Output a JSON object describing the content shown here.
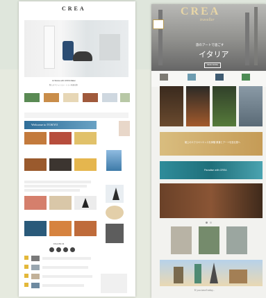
{
  "left_page": {
    "logo": "CREA",
    "nav": [
      "TOP",
      "TRAVEL",
      "GOURMET",
      "BEAUTY",
      "FASHION",
      "LIFESTYLE",
      "CULTURE",
      "MONEY",
      "WEB",
      "SHOP"
    ],
    "hero_caption": "14 Stories with JUNYA Makei",
    "hero_subcaption": "新しいファッション・ショーを巡る旅",
    "welcome_banner": "Welcome to TOKYO",
    "section_label": "FOLLOW US"
  },
  "right_page": {
    "logo": "CREA",
    "logo_script": "traveller",
    "hero_title_small": "旅のアートで過ごす",
    "hero_title": "イタリア",
    "hero_button": "READ MORE",
    "feature_banner_text": "極上のエクスペリエンスを体験 美食とアートを巡る旅へ",
    "ticker_text": "Paradise with CREA",
    "footer_text": "If you travel today..."
  },
  "colors": {
    "background": "#e6eadf",
    "accent_gold": "#c9a55a",
    "accent_teal": "#1f6f7a"
  }
}
